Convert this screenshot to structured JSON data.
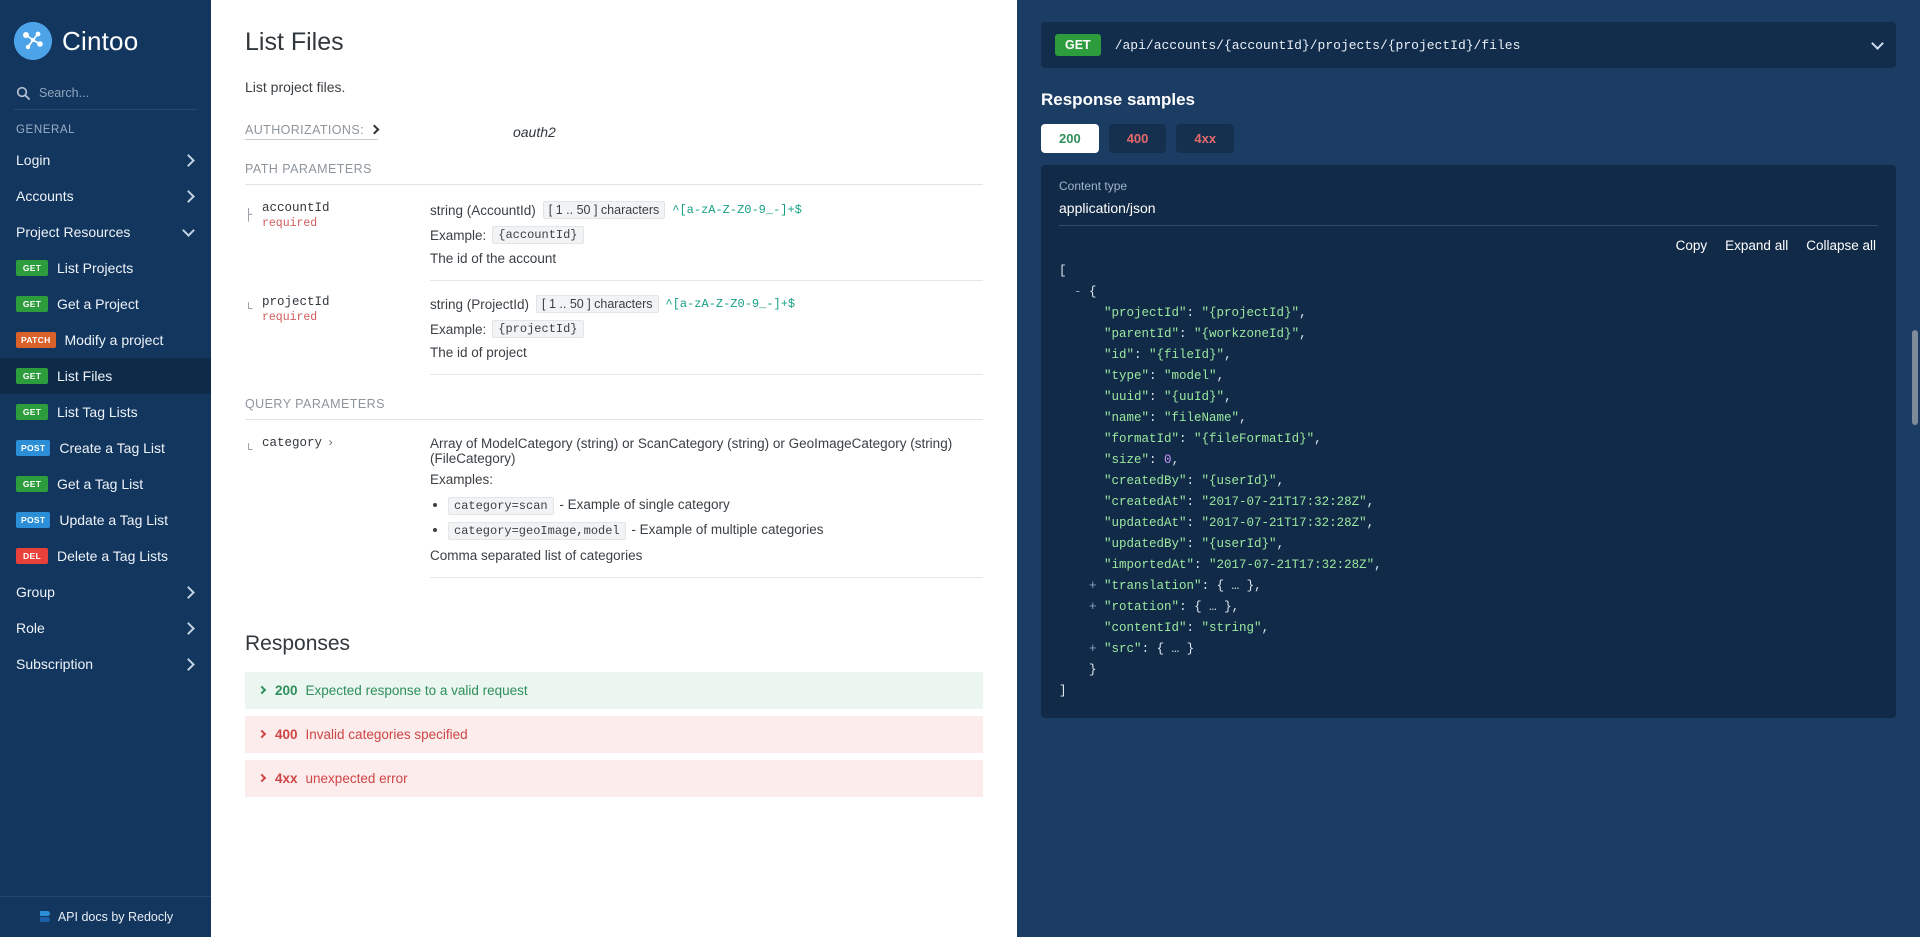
{
  "sidebar": {
    "brand": "Cintoo",
    "search_placeholder": "Search...",
    "group_title": "GENERAL",
    "items": [
      {
        "label": "Login",
        "type": "section",
        "chevron": "right"
      },
      {
        "label": "Accounts",
        "type": "section",
        "chevron": "right"
      },
      {
        "label": "Project Resources",
        "type": "section",
        "chevron": "down"
      },
      {
        "label": "List Projects",
        "method": "GET",
        "type": "op"
      },
      {
        "label": "Get a Project",
        "method": "GET",
        "type": "op"
      },
      {
        "label": "Modify a project",
        "method": "PATCH",
        "type": "op"
      },
      {
        "label": "List Files",
        "method": "GET",
        "type": "op",
        "active": true
      },
      {
        "label": "List Tag Lists",
        "method": "GET",
        "type": "op"
      },
      {
        "label": "Create a Tag List",
        "method": "POST",
        "type": "op"
      },
      {
        "label": "Get a Tag List",
        "method": "GET",
        "type": "op"
      },
      {
        "label": "Update a Tag List",
        "method": "POST",
        "type": "op"
      },
      {
        "label": "Delete a Tag Lists",
        "method": "DEL",
        "type": "op"
      },
      {
        "label": "Group",
        "type": "section",
        "chevron": "right"
      },
      {
        "label": "Role",
        "type": "section",
        "chevron": "right"
      },
      {
        "label": "Subscription",
        "type": "section",
        "chevron": "right"
      }
    ],
    "footer": "API docs by Redocly"
  },
  "doc": {
    "title": "List Files",
    "description": "List project files.",
    "auth_label": "AUTHORIZATIONS:",
    "auth_value": "oauth2",
    "path_params_heading": "PATH PARAMETERS",
    "query_params_heading": "QUERY PARAMETERS",
    "path_params": [
      {
        "name": "accountId",
        "required": "required",
        "type": "string (AccountId)",
        "constraint": "[ 1 .. 50 ] characters",
        "pattern": "^[a-zA-Z-Z0-9_-]+$",
        "example_label": "Example:",
        "example_value": "{accountId}",
        "description": "The id of the account"
      },
      {
        "name": "projectId",
        "required": "required",
        "type": "string (ProjectId)",
        "constraint": "[ 1 .. 50 ] characters",
        "pattern": "^[a-zA-Z-Z0-9_-]+$",
        "example_label": "Example:",
        "example_value": "{projectId}",
        "description": "The id of project"
      }
    ],
    "query_params": [
      {
        "name": "category",
        "type": "Array of ModelCategory (string) or ScanCategory (string) or GeoImageCategory (string) (FileCategory)",
        "examples_label": "Examples:",
        "examples": [
          {
            "code": "category=scan",
            "text": "- Example of single category"
          },
          {
            "code": "category=geoImage,model",
            "text": "- Example of multiple categories"
          }
        ],
        "description": "Comma separated list of categories"
      }
    ],
    "responses_title": "Responses",
    "responses": [
      {
        "code": "200",
        "desc": "Expected response to a valid request",
        "status": "ok"
      },
      {
        "code": "400",
        "desc": "Invalid categories specified",
        "status": "err"
      },
      {
        "code": "4xx",
        "desc": "unexpected error",
        "status": "err"
      }
    ]
  },
  "right": {
    "method": "GET",
    "path": "/api/accounts/{accountId}/projects/{projectId}/files",
    "samples_title": "Response samples",
    "tabs": [
      {
        "label": "200",
        "status": "ok",
        "active": true
      },
      {
        "label": "400",
        "status": "err",
        "active": false
      },
      {
        "label": "4xx",
        "status": "err",
        "active": false
      }
    ],
    "content_type_label": "Content type",
    "content_type_value": "application/json",
    "actions": [
      "Copy",
      "Expand all",
      "Collapse all"
    ],
    "json_lines": [
      {
        "indent": 0,
        "text": "["
      },
      {
        "indent": 1,
        "fold": "-",
        "text": "{"
      },
      {
        "indent": 3,
        "key": "\"projectId\"",
        "sep": ": ",
        "val": "\"{projectId}\"",
        "vtype": "s",
        "tail": ","
      },
      {
        "indent": 3,
        "key": "\"parentId\"",
        "sep": ": ",
        "val": "\"{workzoneId}\"",
        "vtype": "s",
        "tail": ","
      },
      {
        "indent": 3,
        "key": "\"id\"",
        "sep": ": ",
        "val": "\"{fileId}\"",
        "vtype": "s",
        "tail": ","
      },
      {
        "indent": 3,
        "key": "\"type\"",
        "sep": ": ",
        "val": "\"model\"",
        "vtype": "s",
        "tail": ","
      },
      {
        "indent": 3,
        "key": "\"uuid\"",
        "sep": ": ",
        "val": "\"{uuId}\"",
        "vtype": "s",
        "tail": ","
      },
      {
        "indent": 3,
        "key": "\"name\"",
        "sep": ": ",
        "val": "\"fileName\"",
        "vtype": "s",
        "tail": ","
      },
      {
        "indent": 3,
        "key": "\"formatId\"",
        "sep": ": ",
        "val": "\"{fileFormatId}\"",
        "vtype": "s",
        "tail": ","
      },
      {
        "indent": 3,
        "key": "\"size\"",
        "sep": ": ",
        "val": "0",
        "vtype": "num",
        "tail": ","
      },
      {
        "indent": 3,
        "key": "\"createdBy\"",
        "sep": ": ",
        "val": "\"{userId}\"",
        "vtype": "s",
        "tail": ","
      },
      {
        "indent": 3,
        "key": "\"createdAt\"",
        "sep": ": ",
        "val": "\"2017-07-21T17:32:28Z\"",
        "vtype": "s",
        "tail": ","
      },
      {
        "indent": 3,
        "key": "\"updatedAt\"",
        "sep": ": ",
        "val": "\"2017-07-21T17:32:28Z\"",
        "vtype": "s",
        "tail": ","
      },
      {
        "indent": 3,
        "key": "\"updatedBy\"",
        "sep": ": ",
        "val": "\"{userId}\"",
        "vtype": "s",
        "tail": ","
      },
      {
        "indent": 3,
        "key": "\"importedAt\"",
        "sep": ": ",
        "val": "\"2017-07-21T17:32:28Z\"",
        "vtype": "s",
        "tail": ","
      },
      {
        "indent": 2,
        "fold": "+",
        "key": "\"translation\"",
        "sep": ": ",
        "val": "{ … }",
        "vtype": "p",
        "tail": ","
      },
      {
        "indent": 2,
        "fold": "+",
        "key": "\"rotation\"",
        "sep": ": ",
        "val": "{ … }",
        "vtype": "p",
        "tail": ","
      },
      {
        "indent": 3,
        "key": "\"contentId\"",
        "sep": ": ",
        "val": "\"string\"",
        "vtype": "s",
        "tail": ","
      },
      {
        "indent": 2,
        "fold": "+",
        "key": "\"src\"",
        "sep": ": ",
        "val": "{ … }",
        "vtype": "p",
        "tail": ""
      },
      {
        "indent": 2,
        "text": "}"
      },
      {
        "indent": 0,
        "text": "]"
      }
    ]
  }
}
